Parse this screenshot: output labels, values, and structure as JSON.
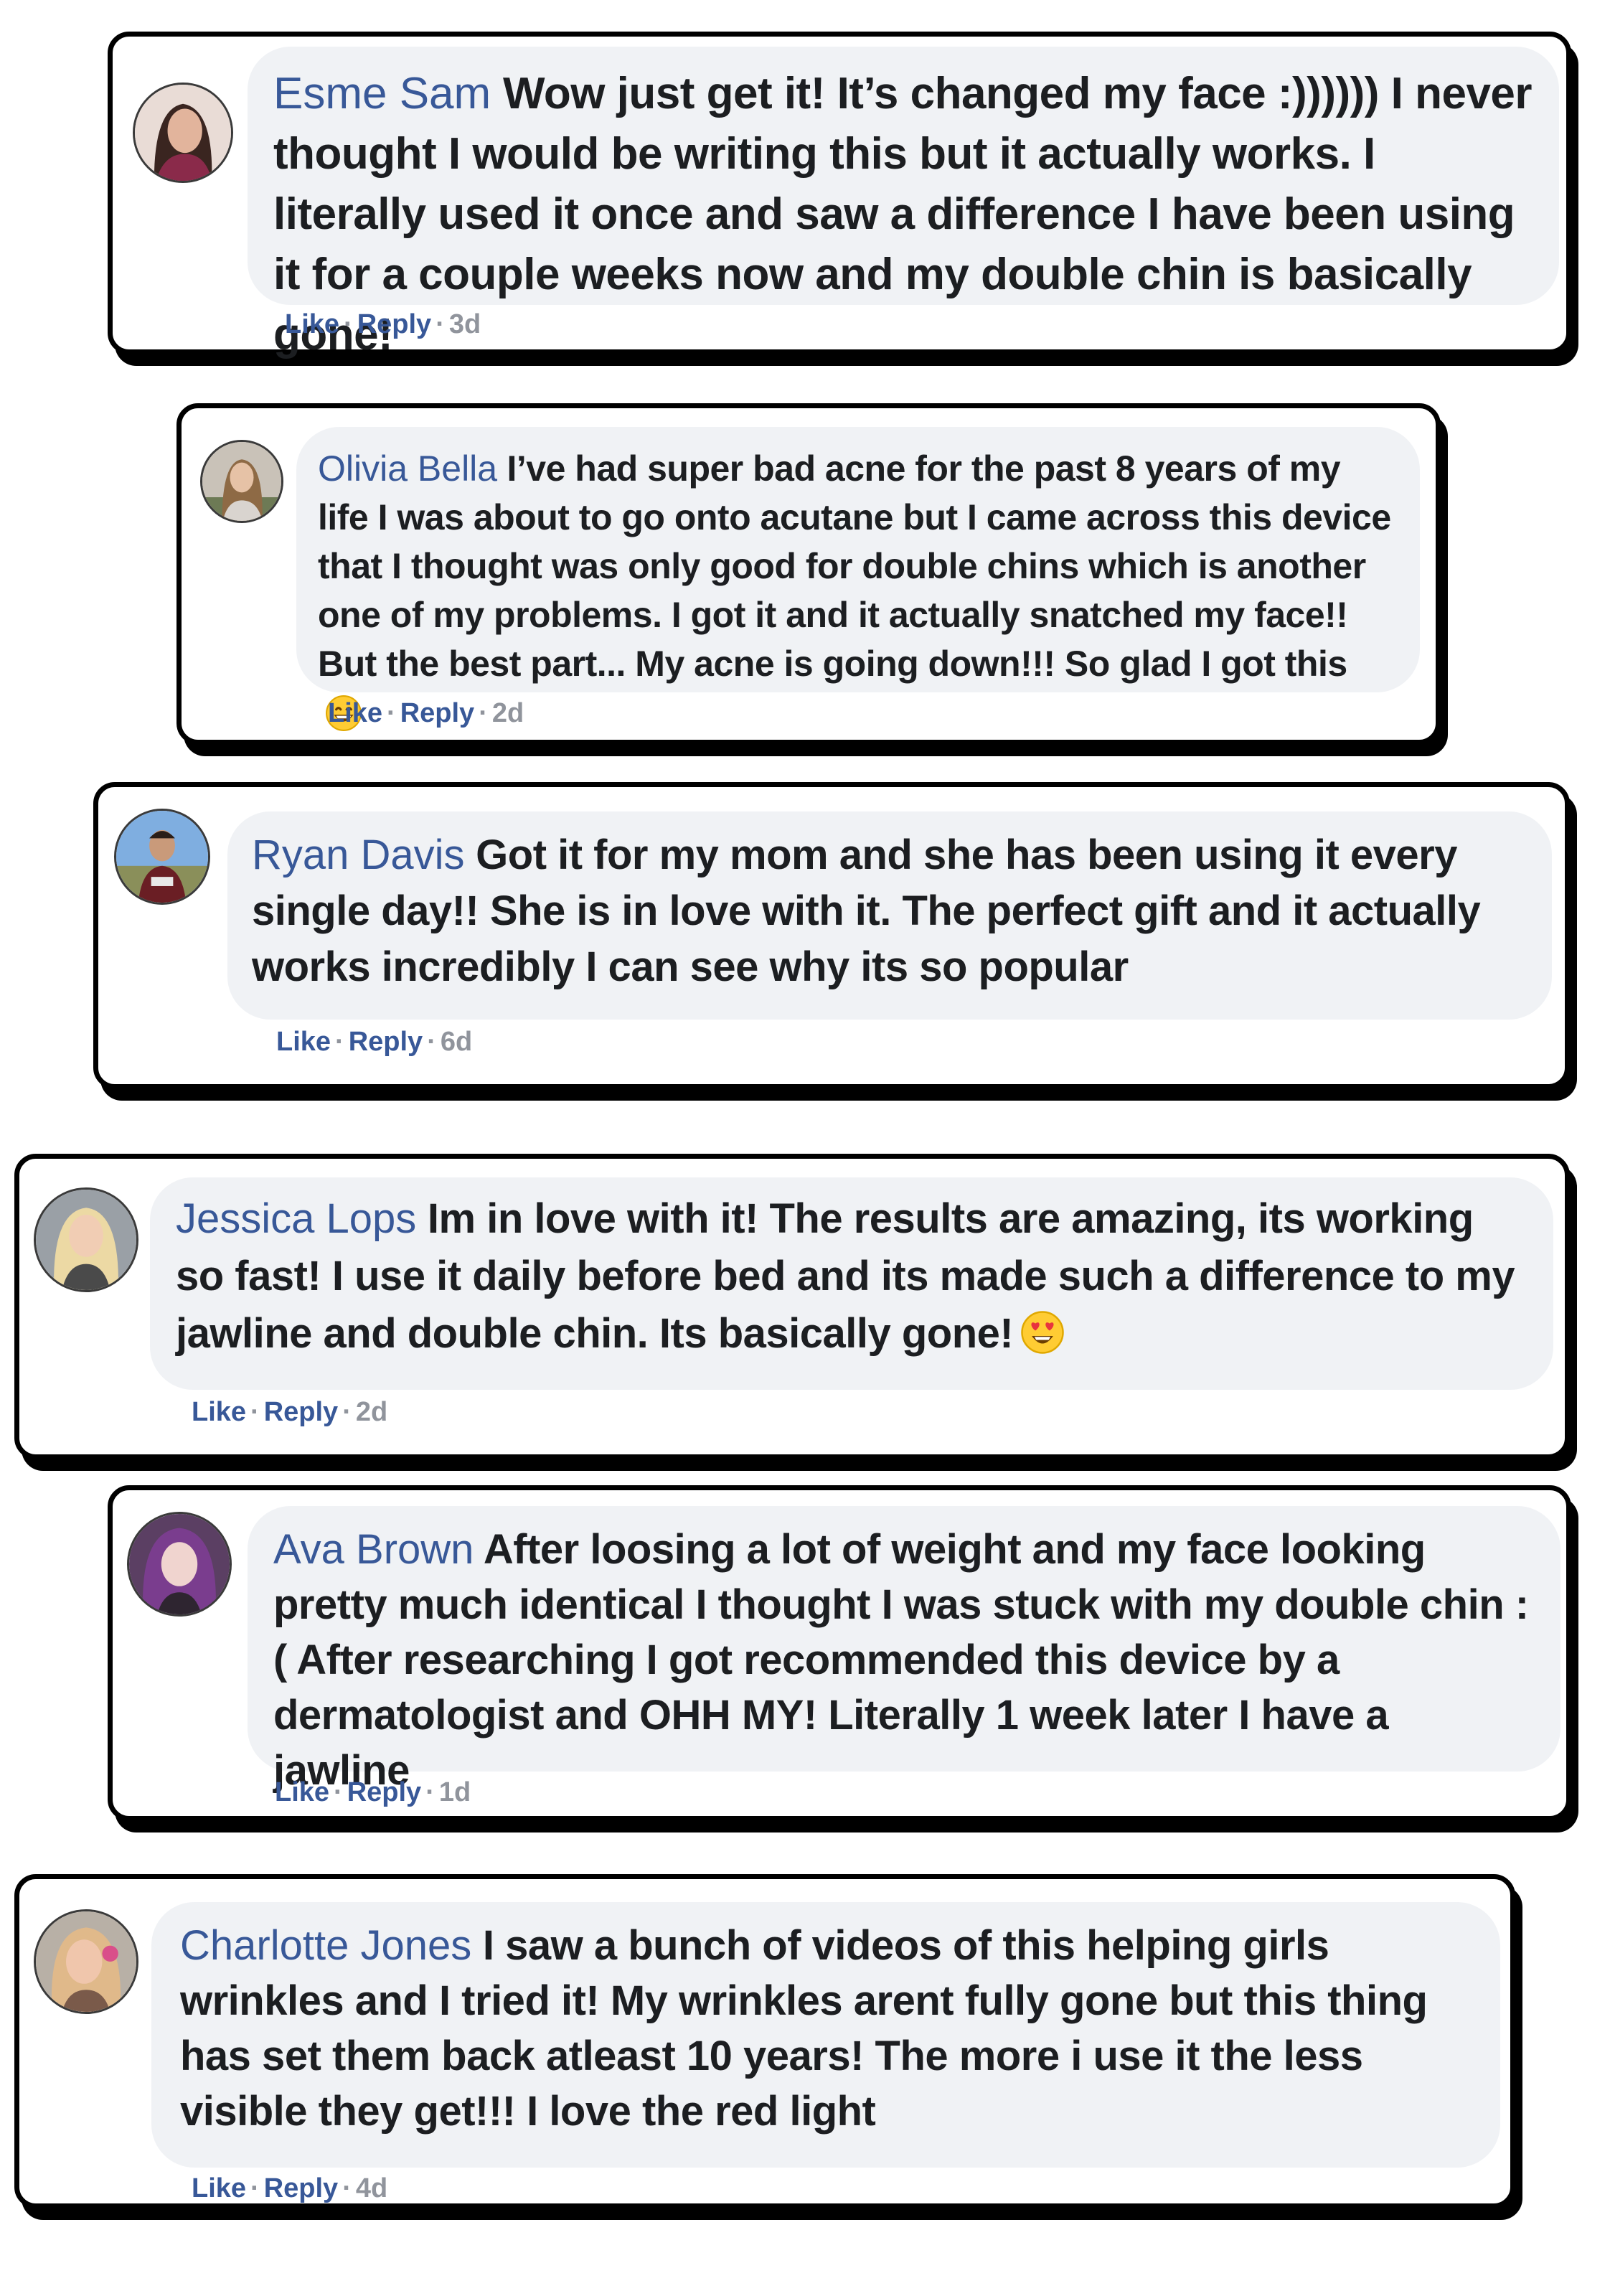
{
  "comments": [
    {
      "name": "Esme Sam",
      "text": "Wow just get it! It’s changed my face :)))))) I never thought I would be writing this but it actually works. I literally used it once and saw a difference I have been using it for a couple weeks now and my double chin is basically gone!",
      "like": "Like",
      "reply": "Reply",
      "age": "3d",
      "emoji": ""
    },
    {
      "name": "Olivia Bella",
      "text": "I’ve had super bad acne for the past 8 years of my life I was about to go onto acutane but I came across this device that I thought was only good for double chins which is another one of my problems. I got it and it actually snatched my face!! But the best part... My acne is going down!!! So glad I got this",
      "like": "Like",
      "reply": "Reply",
      "age": "2d",
      "emoji": "grinning-face"
    },
    {
      "name": "Ryan Davis",
      "text": "Got it for my mom and she has been using it every single day!! She is in love with it. The perfect gift and it actually works incredibly I can see why its so popular",
      "like": "Like",
      "reply": "Reply",
      "age": "6d",
      "emoji": ""
    },
    {
      "name": "Jessica Lops",
      "text": "Im in love with it! The results are amazing, its working so fast! I use it daily before bed and its made such a difference to my jawline and double chin. Its basically gone!",
      "like": "Like",
      "reply": "Reply",
      "age": "2d",
      "emoji": "heart-eyes"
    },
    {
      "name": "Ava Brown",
      "text": "After loosing a lot of weight and my face looking pretty much identical I thought I was stuck with my double chin :( After researching I got recommended this device by a dermatologist and OHH MY! Literally 1 week later I have a jawline",
      "like": "Like",
      "reply": "Reply",
      "age": "1d",
      "emoji": ""
    },
    {
      "name": "Charlotte Jones",
      "text": "I saw a bunch of videos of this helping girls wrinkles and I tried it! My wrinkles arent fully gone but this thing has set them back atleast 10 years! The more i use it the less visible they get!!! I love the red light",
      "like": "Like",
      "reply": "Reply",
      "age": "4d",
      "emoji": ""
    }
  ],
  "separator": "·",
  "colors": {
    "name": "#385898",
    "bubble": "#f0f2f5",
    "text": "#1c1e21",
    "meta": "#90949c",
    "border": "#000000"
  }
}
